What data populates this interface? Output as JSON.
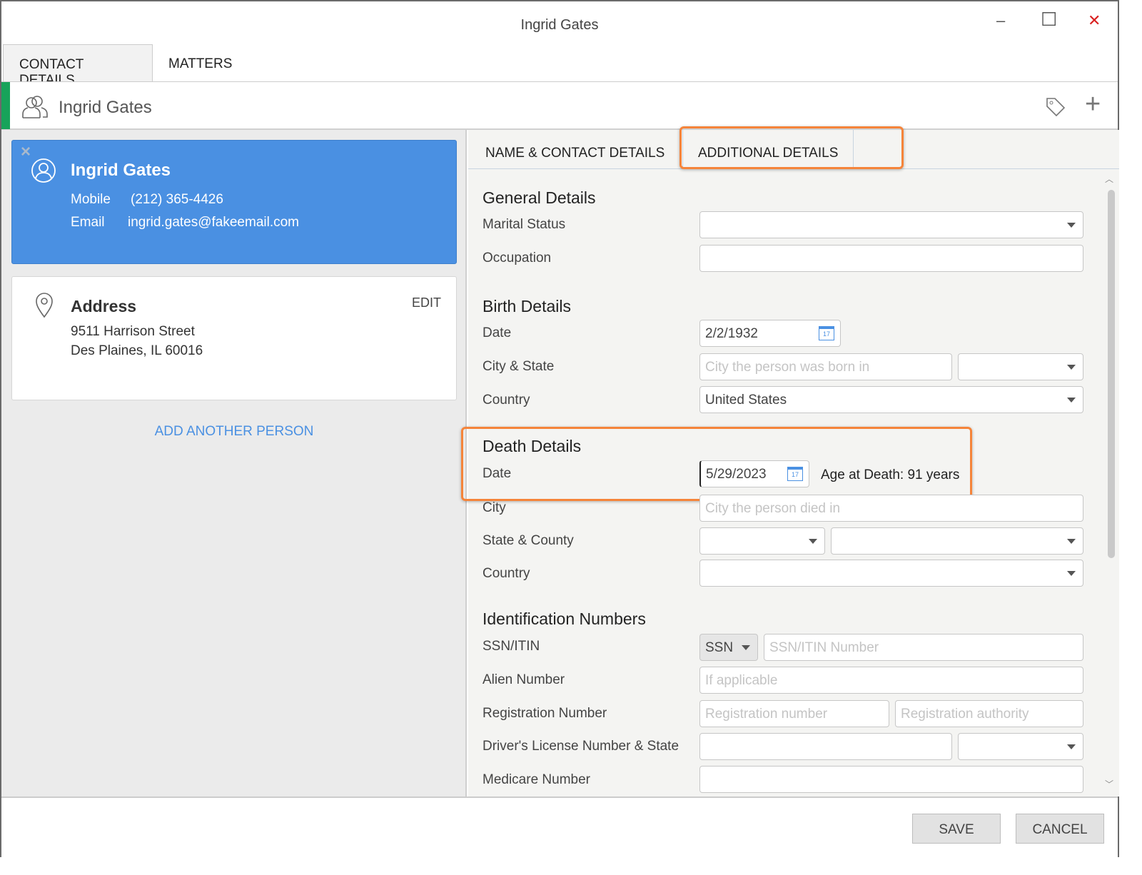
{
  "window": {
    "title": "Ingrid Gates",
    "minimize": "–",
    "maximize": "☐",
    "close": "✕"
  },
  "tabs": [
    {
      "label": "CONTACT DETAILS",
      "active": true
    },
    {
      "label": "MATTERS",
      "active": false
    }
  ],
  "header": {
    "name": "Ingrid Gates",
    "tag_icon": "tag-icon",
    "add_icon": "plus-icon",
    "accent": "#17a35a"
  },
  "person_card": {
    "name": "Ingrid Gates",
    "mobile_label": "Mobile",
    "mobile": "(212) 365-4426",
    "email_label": "Email",
    "email": "ingrid.gates@fakeemail.com",
    "remove": "×",
    "color": "#4a90e2"
  },
  "address_card": {
    "title": "Address",
    "edit": "EDIT",
    "line1": "9511 Harrison Street",
    "line2": "Des Plaines, IL 60016"
  },
  "add_person": "ADD ANOTHER PERSON",
  "subtabs": [
    {
      "label": "NAME & CONTACT DETAILS"
    },
    {
      "label": "ADDITIONAL DETAILS",
      "active": true
    }
  ],
  "general": {
    "title": "General Details",
    "marital_label": "Marital Status",
    "marital": "",
    "occupation_label": "Occupation",
    "occupation": ""
  },
  "birth": {
    "title": "Birth Details",
    "date_label": "Date",
    "date": "2/2/1932",
    "city_state_label": "City & State",
    "city_placeholder": "City the person was born in",
    "country_label": "Country",
    "country": "United States"
  },
  "death": {
    "title": "Death Details",
    "date_label": "Date",
    "date": "5/29/2023",
    "age": "Age at Death: 91 years",
    "city_label": "City",
    "city_placeholder": "City the person died in",
    "state_county_label": "State & County",
    "country_label": "Country"
  },
  "ids": {
    "title": "Identification Numbers",
    "ssn_label": "SSN/ITIN",
    "ssn_type": "SSN",
    "ssn_placeholder": "SSN/ITIN Number",
    "alien_label": "Alien Number",
    "alien_placeholder": "If applicable",
    "reg_label": "Registration Number",
    "reg_placeholder": "Registration number",
    "reg_auth_placeholder": "Registration authority",
    "dl_label": "Driver's License Number & State",
    "medicare_label": "Medicare Number"
  },
  "calendar_day": "17",
  "footer": {
    "save": "SAVE",
    "cancel": "CANCEL"
  },
  "highlight_color": "#f5843a"
}
